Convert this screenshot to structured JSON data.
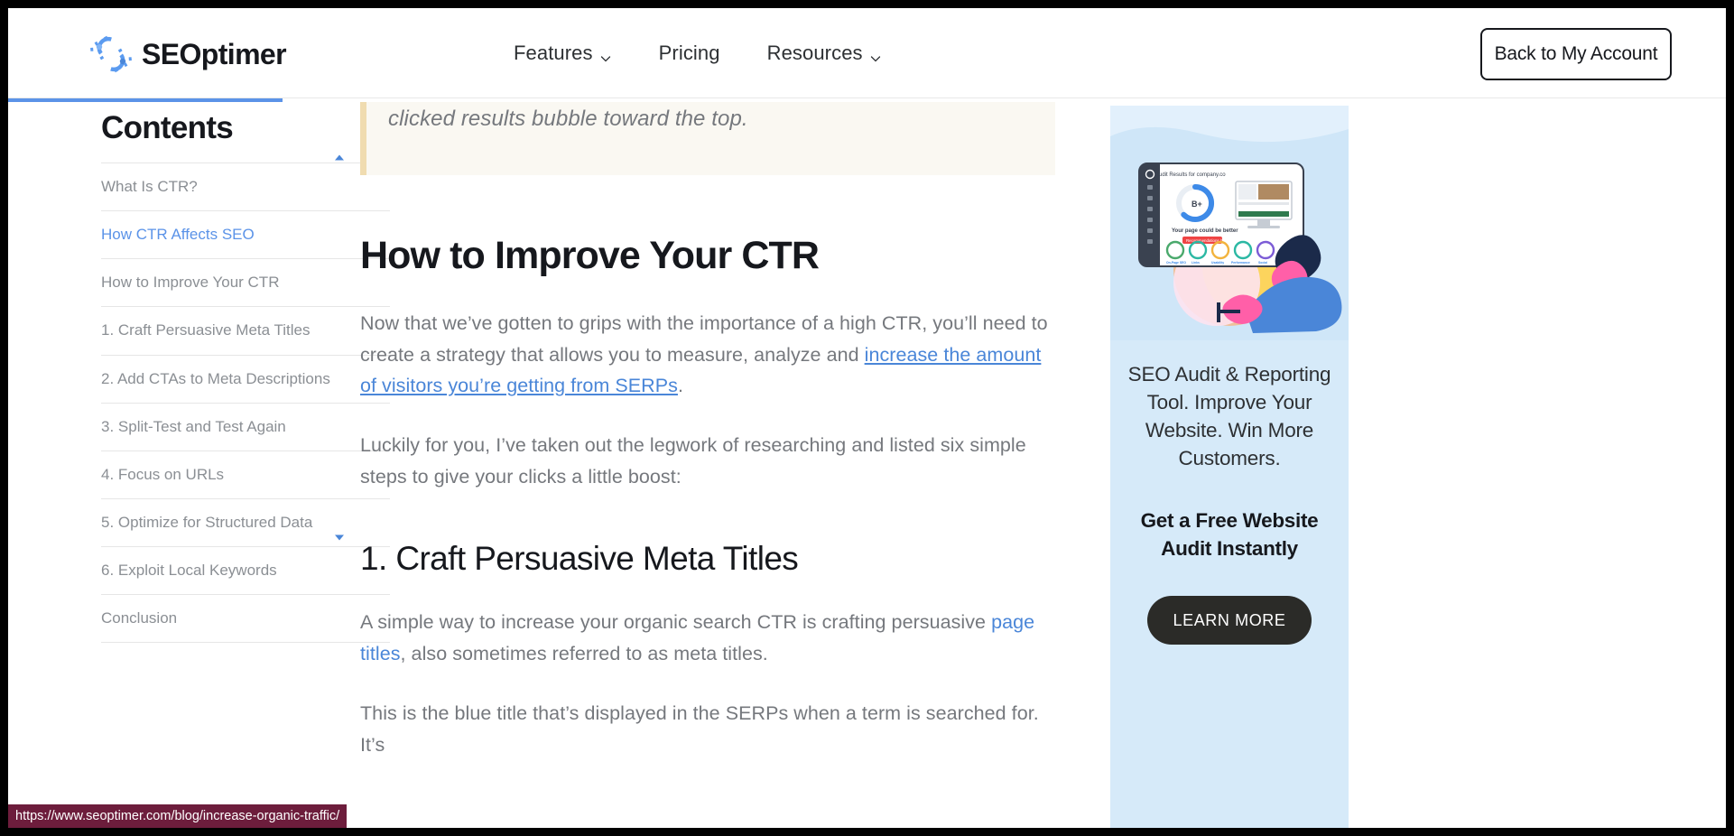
{
  "header": {
    "logo_text": "SEOptimer",
    "logo_icon": "seoptimer-gear-logo",
    "nav": [
      {
        "label": "Features",
        "has_dropdown": true,
        "icon": "chevron-down-icon"
      },
      {
        "label": "Pricing",
        "has_dropdown": false,
        "icon": ""
      },
      {
        "label": "Resources",
        "has_dropdown": true,
        "icon": "chevron-down-icon"
      }
    ],
    "account_button": "Back to My Account"
  },
  "progress": {
    "percent": 16,
    "color": "#5b93e8"
  },
  "toc": {
    "title": "Contents",
    "scroll_up_icon": "triangle-up-icon",
    "scroll_down_icon": "triangle-down-icon",
    "items": [
      {
        "label": "What Is CTR?",
        "active": false
      },
      {
        "label": "How CTR Affects SEO",
        "active": true
      },
      {
        "label": "How to Improve Your CTR",
        "active": false
      },
      {
        "label": "1. Craft Persuasive Meta Titles",
        "active": false
      },
      {
        "label": "2. Add CTAs to Meta Descriptions",
        "active": false
      },
      {
        "label": "3. Split-Test and Test Again",
        "active": false
      },
      {
        "label": "4. Focus on URLs",
        "active": false
      },
      {
        "label": "5. Optimize for Structured Data",
        "active": false
      },
      {
        "label": "6. Exploit Local Keywords",
        "active": false
      },
      {
        "label": "Conclusion",
        "active": false
      }
    ]
  },
  "article": {
    "quote_text": "clicked results bubble toward the top.",
    "heading_h2": "How to Improve Your CTR",
    "para1_a": "Now that we’ve gotten to grips with the importance of a high CTR, you’ll need to create a strategy that allows you to measure, analyze and ",
    "para1_link": "increase the amount of visitors you’re getting from SERPs",
    "para1_b": ".",
    "para2": "Luckily for you, I’ve taken out the legwork of researching and listed six simple steps to give your clicks a little boost:",
    "heading_h3": "1. Craft Persuasive Meta Titles",
    "para3_a": "A simple way to increase your organic search CTR is crafting persuasive ",
    "para3_link": "page titles",
    "para3_b": ", also sometimes referred to as meta titles.",
    "para4": "This is the blue title that’s displayed in the SERPs when a term is searched for. It’s"
  },
  "ad": {
    "illustration_alt": "seo-audit-dashboard-illustration",
    "dashboard_title": "Audit Results for company.co",
    "dashboard_grade": "B+",
    "dashboard_subtitle": "Your page could be better",
    "dashboard_button": "Recommendations (5)",
    "dashboard_metrics": [
      "On-Page SEO",
      "Links",
      "Usability",
      "Performance",
      "Social"
    ],
    "copy": "SEO Audit & Reporting Tool. Improve Your Website. Win More Customers.",
    "headline": "Get a Free Website Audit Instantly",
    "cta_label": "LEARN MORE",
    "bg_color": "#d6eaf9",
    "cta_bg": "#2b2b28"
  },
  "status_bar": {
    "url": "https://www.seoptimer.com/blog/increase-organic-traffic/",
    "bg_color": "#6d1d3c"
  }
}
